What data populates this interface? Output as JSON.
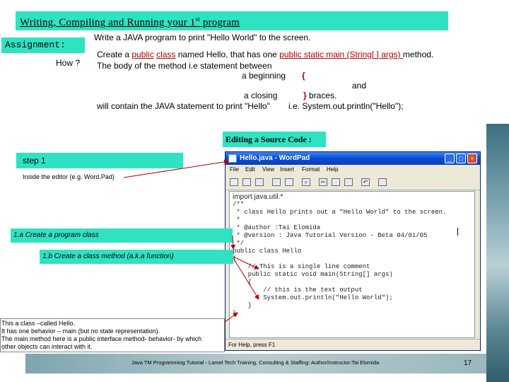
{
  "slide": {
    "title_main": "Writing, Compiling and Running your 1",
    "title_sup": "st",
    "title_tail": " program",
    "assignment_label": "Assignment:",
    "how_label": "How ?",
    "intro": "Write a JAVA program to print \"Hello World\" to the screen.",
    "how": {
      "p1": "Create a ",
      "public": "public",
      "space": " ",
      "class_kw": "class",
      "p2": " named Hello, that has one ",
      "main_sig": "public static main (String[ ] args) ",
      "p3": "method.",
      "line2": "The body of the method i.e statement between",
      "a_beginning": "a beginning",
      "open_brace": "{",
      "and": "and",
      "a_closing": "a closing",
      "close_brace": "}",
      "braces": "braces.",
      "will_contain": "will contain the JAVA statement to print \"Hello\"",
      "ie_print": "i.e. System.out.println(\"Hello\");"
    },
    "editing_label": "Editing a Source Code :",
    "step1": "step 1",
    "inside_editor": "Inside the editor (e.g. Word.Pad)",
    "step_1a": "1.a Create a program class",
    "step_1b": "1.b Create a class method (a.k.a function)",
    "note_lines": [
      "This a class –called Hello.",
      "It has one behavior – main (but no state representation).",
      "The main method here is a public interface method- behavior- by which",
      "other objects can interact with it."
    ],
    "footer": "Java TM Programming Tutorial - Lamel Tech Training, Consulting & Staffing: Author/Instructor:Tai Elomida",
    "page_number": "17"
  },
  "wordpad": {
    "title": "Hello.java - WordPad",
    "menu": [
      "File",
      "Edit",
      "View",
      "Insert",
      "Format",
      "Help"
    ],
    "toolbar_icons": [
      "new-icon",
      "open-icon",
      "save-icon",
      "print-icon",
      "preview-icon",
      "find-icon",
      "cut-icon",
      "copy-icon",
      "paste-icon",
      "undo-icon",
      "datetime-icon"
    ],
    "code_lines": [
      "import java.util.*",
      "/**",
      " * class Hello prints out a \"Hello World\" to the screen.",
      " *",
      " * @author :Tai Elomida",
      " * @version : Java Tutorial Version - Beta 04/01/05",
      " */",
      "public class Hello",
      "{",
      "    // This is a single line comment",
      "    public static void main(String[] args)",
      "    {",
      "        // this is the text output",
      "        System.out.println(\"Hello World\");",
      "    }",
      "}"
    ],
    "status": "For Help, press F1",
    "colors": {
      "title_bar": "#0a4ed8",
      "close_button": "#d84b2a"
    }
  },
  "colors": {
    "accent_box": "#2fe2c2",
    "arrow": "#b00000"
  }
}
